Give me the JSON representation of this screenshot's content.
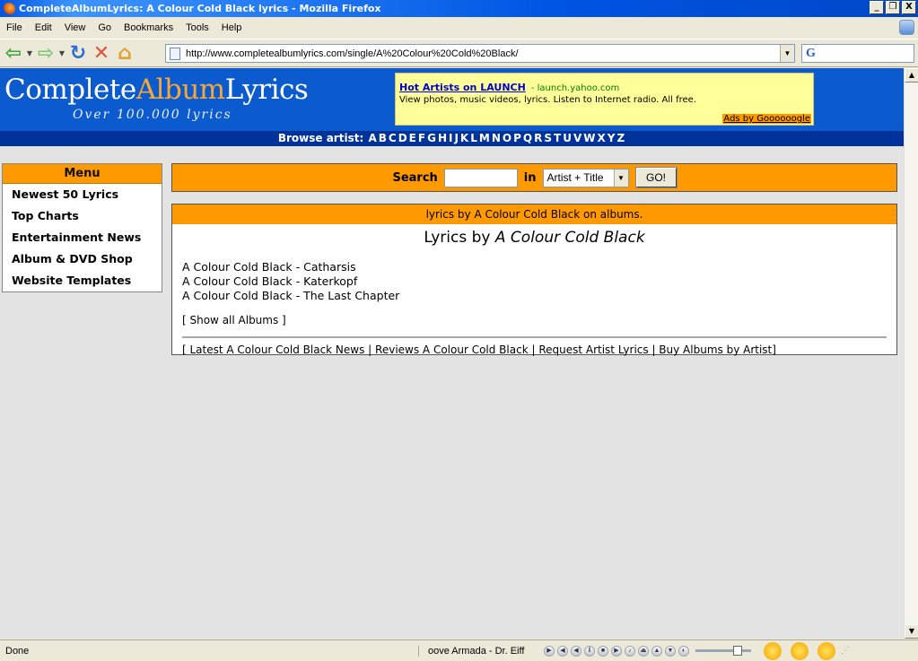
{
  "window": {
    "title": "CompleteAlbumLyrics: A Colour Cold Black lyrics - Mozilla Firefox",
    "controls": [
      "_",
      "❐",
      "X"
    ]
  },
  "menu": {
    "items": [
      "File",
      "Edit",
      "View",
      "Go",
      "Bookmarks",
      "Tools",
      "Help"
    ]
  },
  "nav": {
    "url": "http://www.completealbumlyrics.com/single/A%20Colour%20Cold%20Black/",
    "search_engine_glyph": "G"
  },
  "site": {
    "logo_part1": "Complete",
    "logo_part2": "Album",
    "logo_part3": "Lyrics",
    "logo_tagline": "Over 100.000 lyrics",
    "ad": {
      "title": "Hot Artists on LAUNCH",
      "url": "- launch.yahoo.com",
      "desc": "View photos, music videos, lyrics. Listen to Internet radio. All free.",
      "credit": "Ads by Goooooogle"
    },
    "browse_label": "Browse artist:",
    "browse_letters": [
      "A",
      "B",
      "C",
      "D",
      "E",
      "F",
      "G",
      "H",
      "I",
      "J",
      "K",
      "L",
      "M",
      "N",
      "O",
      "P",
      "Q",
      "R",
      "S",
      "T",
      "U",
      "V",
      "W",
      "X",
      "Y",
      "Z"
    ]
  },
  "leftmenu": {
    "heading": "Menu",
    "items": [
      "Newest 50 Lyrics",
      "Top Charts",
      "Entertainment News",
      "Album & DVD Shop",
      "Website Templates"
    ]
  },
  "search": {
    "label": "Search",
    "in_label": "in",
    "field_value": "",
    "select_value": "Artist + Title",
    "button": "GO!"
  },
  "content": {
    "header": "lyrics by A Colour Cold Black on albums.",
    "title_prefix": "Lyrics by",
    "title_artist": "A Colour Cold Black",
    "songs": [
      "A Colour Cold Black - Catharsis",
      "A Colour Cold Black - Katerkopf",
      "A Colour Cold Black - The Last Chapter"
    ],
    "show_all": "[ Show all Albums ]",
    "links": "[ Latest A Colour Cold Black News | Reviews A Colour Cold Black | Request Artist Lyrics | Buy Albums by Artist]"
  },
  "status": {
    "text": "Done",
    "now_playing": "oove Armada - Dr. Eiff"
  }
}
